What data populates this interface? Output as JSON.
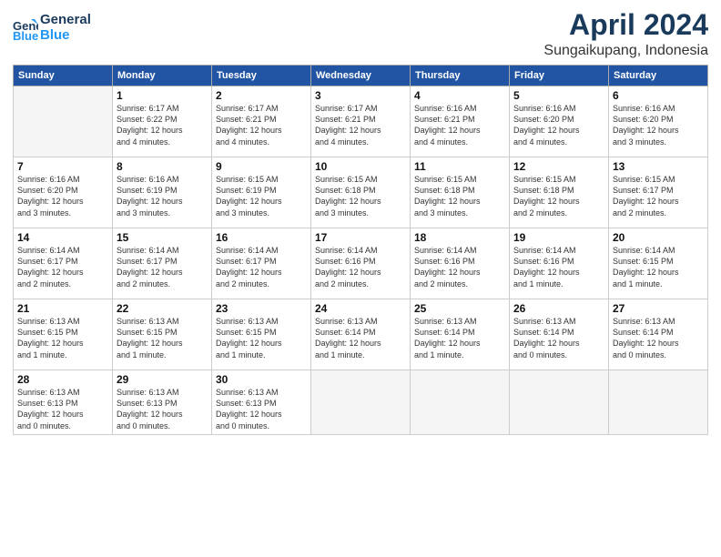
{
  "header": {
    "logo_line1": "General",
    "logo_line2": "Blue",
    "month": "April 2024",
    "location": "Sungaikupang, Indonesia"
  },
  "weekdays": [
    "Sunday",
    "Monday",
    "Tuesday",
    "Wednesday",
    "Thursday",
    "Friday",
    "Saturday"
  ],
  "weeks": [
    [
      {
        "day": "",
        "text": ""
      },
      {
        "day": "1",
        "text": "Sunrise: 6:17 AM\nSunset: 6:22 PM\nDaylight: 12 hours\nand 4 minutes."
      },
      {
        "day": "2",
        "text": "Sunrise: 6:17 AM\nSunset: 6:21 PM\nDaylight: 12 hours\nand 4 minutes."
      },
      {
        "day": "3",
        "text": "Sunrise: 6:17 AM\nSunset: 6:21 PM\nDaylight: 12 hours\nand 4 minutes."
      },
      {
        "day": "4",
        "text": "Sunrise: 6:16 AM\nSunset: 6:21 PM\nDaylight: 12 hours\nand 4 minutes."
      },
      {
        "day": "5",
        "text": "Sunrise: 6:16 AM\nSunset: 6:20 PM\nDaylight: 12 hours\nand 4 minutes."
      },
      {
        "day": "6",
        "text": "Sunrise: 6:16 AM\nSunset: 6:20 PM\nDaylight: 12 hours\nand 3 minutes."
      }
    ],
    [
      {
        "day": "7",
        "text": "Sunrise: 6:16 AM\nSunset: 6:20 PM\nDaylight: 12 hours\nand 3 minutes."
      },
      {
        "day": "8",
        "text": "Sunrise: 6:16 AM\nSunset: 6:19 PM\nDaylight: 12 hours\nand 3 minutes."
      },
      {
        "day": "9",
        "text": "Sunrise: 6:15 AM\nSunset: 6:19 PM\nDaylight: 12 hours\nand 3 minutes."
      },
      {
        "day": "10",
        "text": "Sunrise: 6:15 AM\nSunset: 6:18 PM\nDaylight: 12 hours\nand 3 minutes."
      },
      {
        "day": "11",
        "text": "Sunrise: 6:15 AM\nSunset: 6:18 PM\nDaylight: 12 hours\nand 3 minutes."
      },
      {
        "day": "12",
        "text": "Sunrise: 6:15 AM\nSunset: 6:18 PM\nDaylight: 12 hours\nand 2 minutes."
      },
      {
        "day": "13",
        "text": "Sunrise: 6:15 AM\nSunset: 6:17 PM\nDaylight: 12 hours\nand 2 minutes."
      }
    ],
    [
      {
        "day": "14",
        "text": "Sunrise: 6:14 AM\nSunset: 6:17 PM\nDaylight: 12 hours\nand 2 minutes."
      },
      {
        "day": "15",
        "text": "Sunrise: 6:14 AM\nSunset: 6:17 PM\nDaylight: 12 hours\nand 2 minutes."
      },
      {
        "day": "16",
        "text": "Sunrise: 6:14 AM\nSunset: 6:17 PM\nDaylight: 12 hours\nand 2 minutes."
      },
      {
        "day": "17",
        "text": "Sunrise: 6:14 AM\nSunset: 6:16 PM\nDaylight: 12 hours\nand 2 minutes."
      },
      {
        "day": "18",
        "text": "Sunrise: 6:14 AM\nSunset: 6:16 PM\nDaylight: 12 hours\nand 2 minutes."
      },
      {
        "day": "19",
        "text": "Sunrise: 6:14 AM\nSunset: 6:16 PM\nDaylight: 12 hours\nand 1 minute."
      },
      {
        "day": "20",
        "text": "Sunrise: 6:14 AM\nSunset: 6:15 PM\nDaylight: 12 hours\nand 1 minute."
      }
    ],
    [
      {
        "day": "21",
        "text": "Sunrise: 6:13 AM\nSunset: 6:15 PM\nDaylight: 12 hours\nand 1 minute."
      },
      {
        "day": "22",
        "text": "Sunrise: 6:13 AM\nSunset: 6:15 PM\nDaylight: 12 hours\nand 1 minute."
      },
      {
        "day": "23",
        "text": "Sunrise: 6:13 AM\nSunset: 6:15 PM\nDaylight: 12 hours\nand 1 minute."
      },
      {
        "day": "24",
        "text": "Sunrise: 6:13 AM\nSunset: 6:14 PM\nDaylight: 12 hours\nand 1 minute."
      },
      {
        "day": "25",
        "text": "Sunrise: 6:13 AM\nSunset: 6:14 PM\nDaylight: 12 hours\nand 1 minute."
      },
      {
        "day": "26",
        "text": "Sunrise: 6:13 AM\nSunset: 6:14 PM\nDaylight: 12 hours\nand 0 minutes."
      },
      {
        "day": "27",
        "text": "Sunrise: 6:13 AM\nSunset: 6:14 PM\nDaylight: 12 hours\nand 0 minutes."
      }
    ],
    [
      {
        "day": "28",
        "text": "Sunrise: 6:13 AM\nSunset: 6:13 PM\nDaylight: 12 hours\nand 0 minutes."
      },
      {
        "day": "29",
        "text": "Sunrise: 6:13 AM\nSunset: 6:13 PM\nDaylight: 12 hours\nand 0 minutes."
      },
      {
        "day": "30",
        "text": "Sunrise: 6:13 AM\nSunset: 6:13 PM\nDaylight: 12 hours\nand 0 minutes."
      },
      {
        "day": "",
        "text": ""
      },
      {
        "day": "",
        "text": ""
      },
      {
        "day": "",
        "text": ""
      },
      {
        "day": "",
        "text": ""
      }
    ]
  ]
}
